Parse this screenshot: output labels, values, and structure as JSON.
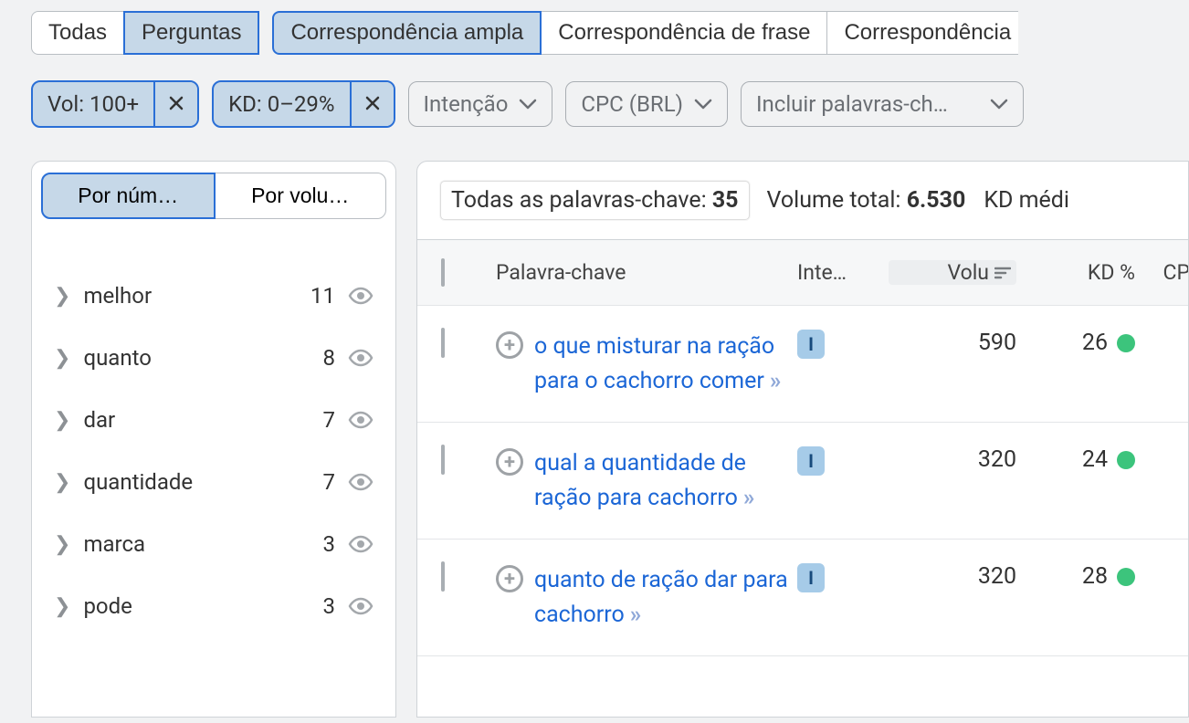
{
  "tabs": {
    "all": "Todas",
    "questions": "Perguntas",
    "broad": "Correspondência ampla",
    "phrase": "Correspondência de frase",
    "exact_partial": "Correspondência"
  },
  "filters": {
    "vol": "Vol: 100+",
    "kd": "KD: 0–29%",
    "intent": "Intenção",
    "cpc": "CPC (BRL)",
    "include": "Incluir palavras-ch…"
  },
  "sidebar": {
    "tab_number": "Por núm…",
    "tab_volume": "Por volu…",
    "items": [
      {
        "word": "melhor",
        "count": "11"
      },
      {
        "word": "quanto",
        "count": "8"
      },
      {
        "word": "dar",
        "count": "7"
      },
      {
        "word": "quantidade",
        "count": "7"
      },
      {
        "word": "marca",
        "count": "3"
      },
      {
        "word": "pode",
        "count": "3"
      }
    ]
  },
  "summary": {
    "all_kw_label": "Todas as palavras-chave: ",
    "all_kw_value": "35",
    "total_vol_label": "Volume total: ",
    "total_vol_value": "6.530",
    "kd_avg_label": "KD médi"
  },
  "table": {
    "headers": {
      "keyword": "Palavra-chave",
      "intent": "Inte…",
      "volume": "Volu",
      "kd": "KD %",
      "cpc": "CP"
    },
    "rows": [
      {
        "keyword": "o que misturar na ração para o cachorro comer",
        "intent": "I",
        "volume": "590",
        "kd": "26"
      },
      {
        "keyword": "qual a quantidade de ração para cachorro",
        "intent": "I",
        "volume": "320",
        "kd": "24"
      },
      {
        "keyword": "quanto de ração dar para cachorro",
        "intent": "I",
        "volume": "320",
        "kd": "28"
      }
    ]
  }
}
